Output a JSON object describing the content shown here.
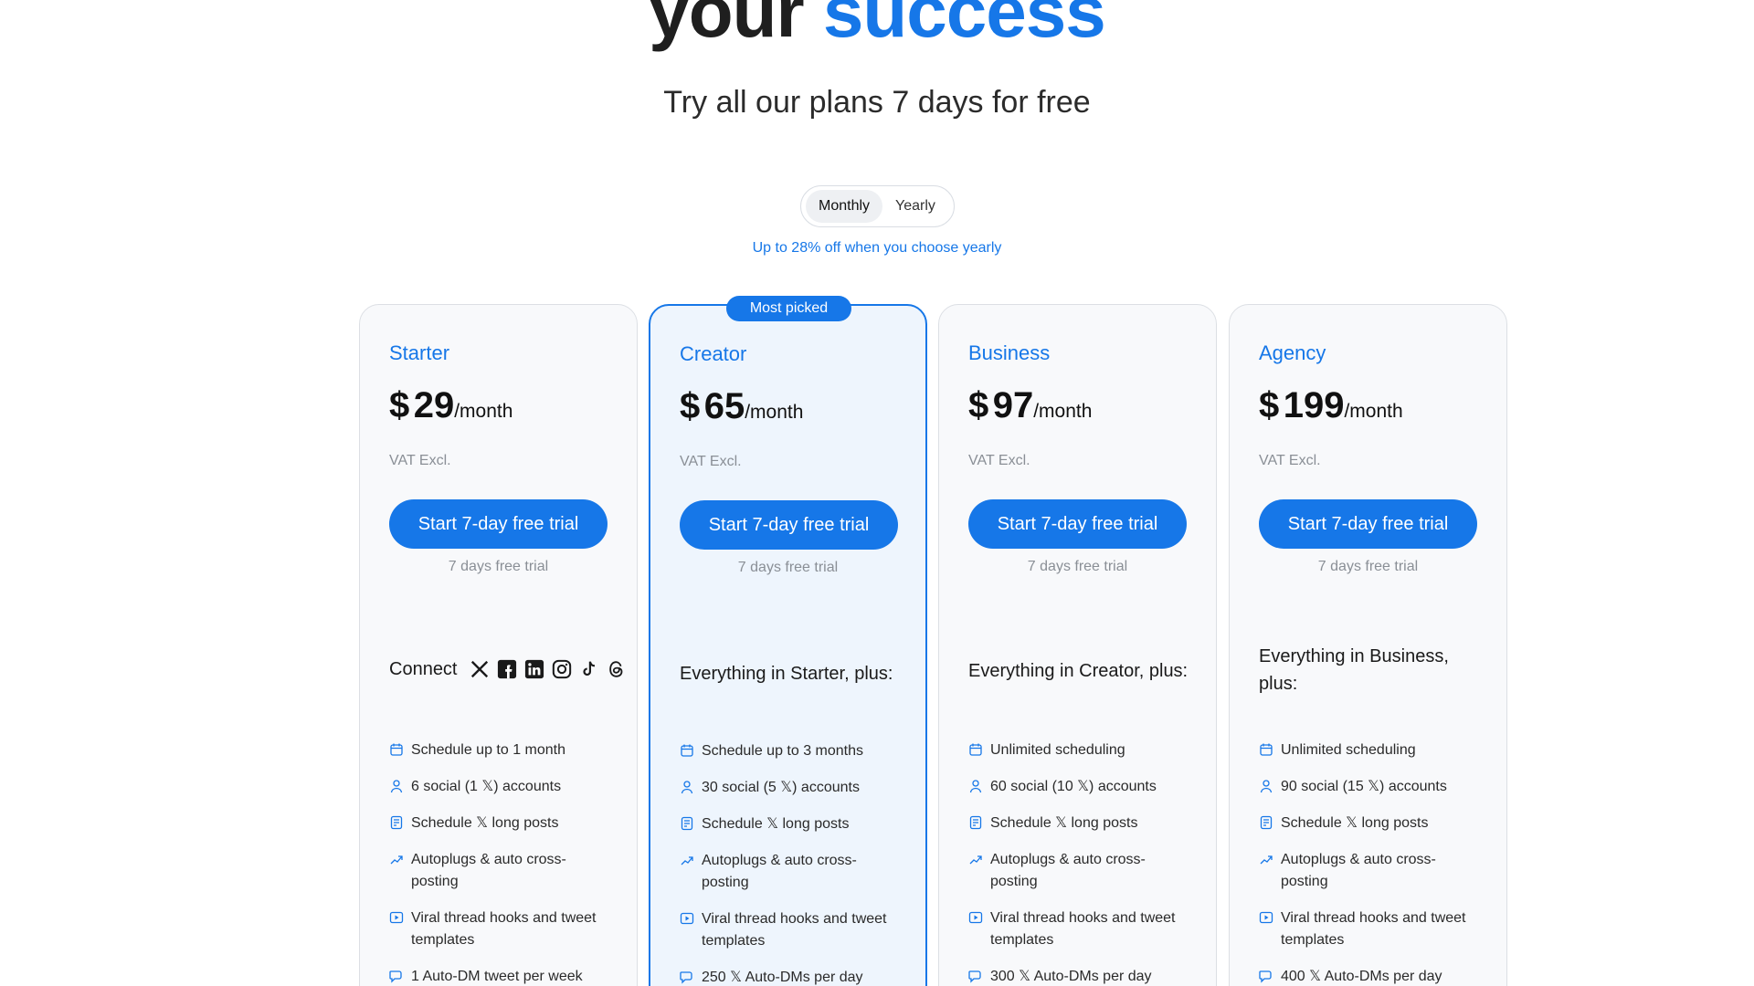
{
  "hero": {
    "title_part1": "your",
    "title_accent": "success",
    "subtitle": "Try all our plans 7 days for free"
  },
  "billing_toggle": {
    "options": [
      "Monthly",
      "Yearly"
    ],
    "selected": "Monthly",
    "discount_note": "Up to 28% off when you choose yearly"
  },
  "plans": [
    {
      "name": "Starter",
      "currency": "$",
      "price": "29",
      "period": "/month",
      "vat": "VAT Excl.",
      "cta": "Start 7-day free trial",
      "trial_note": "7 days free trial",
      "lead": "Connect",
      "connect_icons": [
        "x-icon",
        "facebook-icon",
        "linkedin-icon",
        "instagram-icon",
        "tiktok-icon",
        "threads-icon"
      ],
      "features": [
        {
          "icon": "calendar-icon",
          "text": "Schedule up to 1 month"
        },
        {
          "icon": "user-icon",
          "text": "6 social (1 𝕏) accounts"
        },
        {
          "icon": "document-icon",
          "text": "Schedule 𝕏 long posts"
        },
        {
          "icon": "growth-icon",
          "text": "Autoplugs & auto cross-posting"
        },
        {
          "icon": "play-icon",
          "text": "Viral thread hooks and tweet templates"
        },
        {
          "icon": "chat-icon",
          "text": "1 Auto-DM tweet per week"
        }
      ]
    },
    {
      "name": "Creator",
      "badge": "Most picked",
      "currency": "$",
      "price": "65",
      "period": "/month",
      "vat": "VAT Excl.",
      "cta": "Start 7-day free trial",
      "trial_note": "7 days free trial",
      "lead": "Everything in Starter, plus:",
      "features": [
        {
          "icon": "calendar-icon",
          "text": "Schedule up to 3 months"
        },
        {
          "icon": "user-icon",
          "text": "30 social (5 𝕏) accounts"
        },
        {
          "icon": "document-icon",
          "text": "Schedule 𝕏 long posts"
        },
        {
          "icon": "growth-icon",
          "text": "Autoplugs & auto cross-posting"
        },
        {
          "icon": "play-icon",
          "text": "Viral thread hooks and tweet templates"
        },
        {
          "icon": "chat-icon",
          "text": "250 𝕏 Auto-DMs per day"
        }
      ]
    },
    {
      "name": "Business",
      "currency": "$",
      "price": "97",
      "period": "/month",
      "vat": "VAT Excl.",
      "cta": "Start 7-day free trial",
      "trial_note": "7 days free trial",
      "lead": "Everything in Creator, plus:",
      "features": [
        {
          "icon": "calendar-icon",
          "text": "Unlimited scheduling"
        },
        {
          "icon": "user-icon",
          "text": "60 social (10 𝕏) accounts"
        },
        {
          "icon": "document-icon",
          "text": "Schedule 𝕏 long posts"
        },
        {
          "icon": "growth-icon",
          "text": "Autoplugs & auto cross-posting"
        },
        {
          "icon": "play-icon",
          "text": "Viral thread hooks and tweet templates"
        },
        {
          "icon": "chat-icon",
          "text": "300 𝕏 Auto-DMs per day"
        }
      ]
    },
    {
      "name": "Agency",
      "currency": "$",
      "price": "199",
      "period": "/month",
      "vat": "VAT Excl.",
      "cta": "Start 7-day free trial",
      "trial_note": "7 days free trial",
      "lead": "Everything in Business, plus:",
      "features": [
        {
          "icon": "calendar-icon",
          "text": "Unlimited scheduling"
        },
        {
          "icon": "user-icon",
          "text": "90 social (15 𝕏) accounts"
        },
        {
          "icon": "document-icon",
          "text": "Schedule 𝕏 long posts"
        },
        {
          "icon": "growth-icon",
          "text": "Autoplugs & auto cross-posting"
        },
        {
          "icon": "play-icon",
          "text": "Viral thread hooks and tweet templates"
        },
        {
          "icon": "chat-icon",
          "text": "400 𝕏 Auto-DMs per day"
        }
      ]
    }
  ],
  "colors": {
    "accent": "#1677e8",
    "featured_bg": "#eef5fd",
    "card_bg": "#f8f9fb"
  }
}
